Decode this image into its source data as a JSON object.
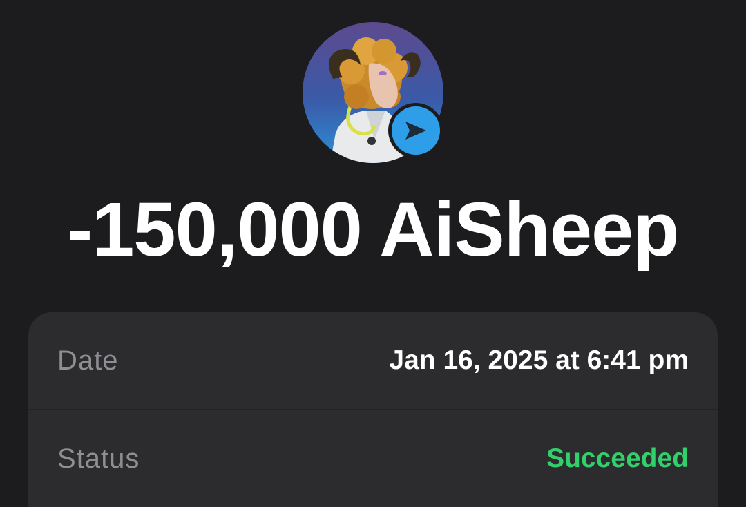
{
  "transaction": {
    "amount": "-150,000 AiSheep",
    "avatar": "sheep-doctor-avatar",
    "badge_icon": "send-arrow-icon",
    "badge_color": "#2e9ee9"
  },
  "details": {
    "date_label": "Date",
    "date_value": "Jan 16, 2025 at 6:41 pm",
    "status_label": "Status",
    "status_value": "Succeeded",
    "status_color": "#30d16b"
  }
}
